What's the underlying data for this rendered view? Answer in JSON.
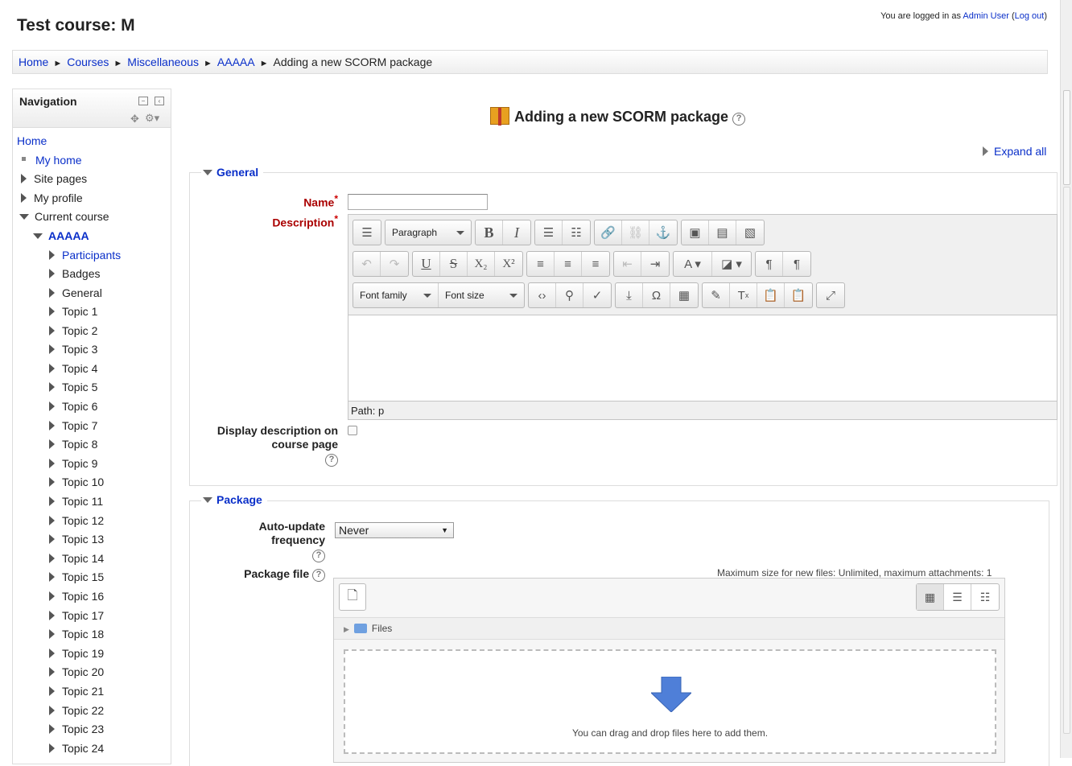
{
  "header": {
    "course_title": "Test course: M",
    "login_prefix": "You are logged in as ",
    "user_name": "Admin User",
    "logout_open": " (",
    "logout_label": "Log out",
    "logout_close": ")"
  },
  "breadcrumb": {
    "items": [
      "Home",
      "Courses",
      "Miscellaneous",
      "AAAAA"
    ],
    "current": "Adding a new SCORM package",
    "separator": "►"
  },
  "navigation": {
    "title": "Navigation",
    "home": "Home",
    "my_home": "My home",
    "site_pages": "Site pages",
    "my_profile": "My profile",
    "current_course": "Current course",
    "course": "AAAAA",
    "participants": "Participants",
    "badges": "Badges",
    "general": "General",
    "topics": [
      "Topic 1",
      "Topic 2",
      "Topic 3",
      "Topic 4",
      "Topic 5",
      "Topic 6",
      "Topic 7",
      "Topic 8",
      "Topic 9",
      "Topic 10",
      "Topic 11",
      "Topic 12",
      "Topic 13",
      "Topic 14",
      "Topic 15",
      "Topic 16",
      "Topic 17",
      "Topic 18",
      "Topic 19",
      "Topic 20",
      "Topic 21",
      "Topic 22",
      "Topic 23",
      "Topic 24"
    ]
  },
  "page": {
    "title": "Adding a new SCORM package",
    "expand_all": "Expand all"
  },
  "general": {
    "legend": "General",
    "name_label": "Name",
    "name_value": "",
    "description_label": "Description",
    "required_mark": "*",
    "editor": {
      "paragraph": "Paragraph",
      "font_family": "Font family",
      "font_size": "Font size",
      "path": "Path: p"
    },
    "display_desc_line1": "Display description on",
    "display_desc_line2": "course page"
  },
  "package": {
    "legend": "Package",
    "auto_update_line1": "Auto-update",
    "auto_update_line2": "frequency",
    "auto_update_value": "Never",
    "package_file_label": "Package file",
    "max_size": "Maximum size for new files: Unlimited, maximum attachments: 1",
    "folder_label": "Files",
    "drop_message": "You can drag and drop files here to add them."
  },
  "colors": {
    "link": "#0a2fc9",
    "required": "#aa0000",
    "drop_arrow": "#4f7fd8"
  }
}
